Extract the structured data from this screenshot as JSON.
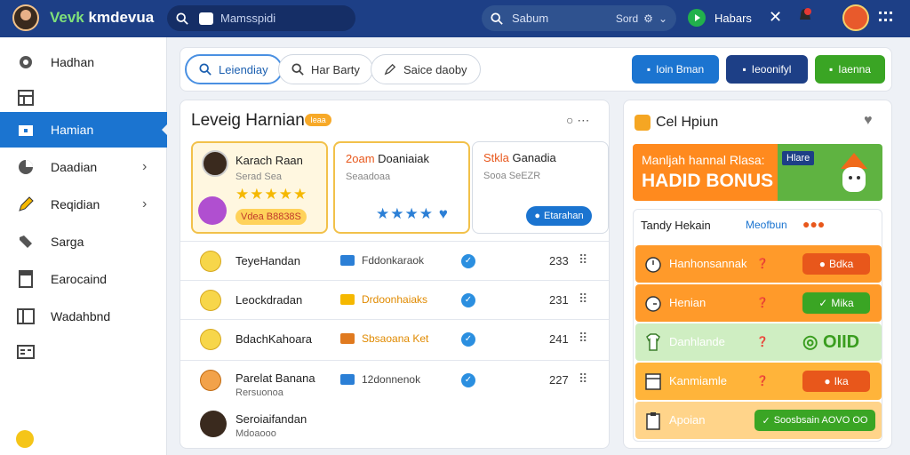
{
  "topbar": {
    "brand_accent": "Vevk",
    "brand_rest": "kmdevua",
    "search_placeholder": "Mamsspidi",
    "search2_placeholder": "Sabum",
    "search2_right": "Sord",
    "status_label": "Habars"
  },
  "sidebar": {
    "items": [
      {
        "label": "Hadhan",
        "icon": "gear-icon"
      },
      {
        "label": "",
        "icon": "calendar-grid-icon"
      },
      {
        "label": "Hamian",
        "icon": "folder-icon"
      },
      {
        "label": "Daadian",
        "icon": "chart-pie-icon"
      },
      {
        "label": "Reqidian",
        "icon": "pencil-icon"
      },
      {
        "label": "Sarga",
        "icon": "tools-icon"
      },
      {
        "label": "Earocaind",
        "icon": "document-icon"
      },
      {
        "label": "Wadahbnd",
        "icon": "archive-icon"
      },
      {
        "label": "",
        "icon": "card-icon"
      }
    ]
  },
  "tabs": [
    {
      "label": "Leiendiay",
      "active": true
    },
    {
      "label": "Har Barty",
      "active": false
    },
    {
      "label": "Saice daoby",
      "active": false
    }
  ],
  "actions": [
    {
      "label": "Ioin Bman",
      "color": "#1b74d0"
    },
    {
      "label": "Ieoonifyl",
      "color": "#1d3f86"
    },
    {
      "label": "Iaenna",
      "color": "#3aa524"
    }
  ],
  "main": {
    "title": "Leveig Harnian",
    "badge": "Ieaa",
    "cards": [
      {
        "name": "Karach Raan",
        "sub": "Serad Sea",
        "stars": "★★★★★",
        "extra": "Vdea  B8838S"
      },
      {
        "name": "Doaniaiak",
        "name_prefix": "2oam",
        "sub": "Seaadoaa",
        "stars": "★★★★"
      },
      {
        "name": "Ganadia",
        "name_prefix": "Stkla",
        "sub": "Sooa SeEZR",
        "button": "Etarahan"
      }
    ],
    "rows": [
      {
        "name": "TeyeHandan",
        "file": "Fddonkaraok",
        "num": "233"
      },
      {
        "name": "Leockdradan",
        "file": "Drdoonhaiaks",
        "num": "231"
      },
      {
        "name": "BdachKahoara",
        "file": "Sbsaoana Ket",
        "num": "241"
      },
      {
        "name": "Parelat Banana",
        "sub": "Rersuonoa",
        "file": "12donnenok",
        "num": "227"
      },
      {
        "name": "Seroiaifandan",
        "sub": "Mdoaooo",
        "file": "",
        "num": ""
      }
    ]
  },
  "right": {
    "title": "Cel Hpiun",
    "banner_line1": "Manljah hannal Rlasa:",
    "banner_line2": "HADID BONUS",
    "banner_tag": "Hlare",
    "list_header": "Tandy Hekain",
    "list_header_right": "Meofbun",
    "items": [
      {
        "label": "Hanhonsannak",
        "pill": "Bdka",
        "bg": "#ff9a2a",
        "pill_color": "#e8571b"
      },
      {
        "label": "Henian",
        "pill": "Mika",
        "bg": "#ff9a2a",
        "pill_color": "#3aa524"
      },
      {
        "label": "Danhlande",
        "pill": "OIID",
        "bg": "#cfeec2",
        "pill_color": "#5fb341"
      },
      {
        "label": "Kanmiamle",
        "pill": "Ika",
        "bg": "#ffb43a",
        "pill_color": "#e8571b"
      },
      {
        "label": "Apoian",
        "pill": "Soosbsain AOVO OO",
        "bg": "#ffd48a",
        "pill_color": "#3aa524"
      }
    ]
  }
}
